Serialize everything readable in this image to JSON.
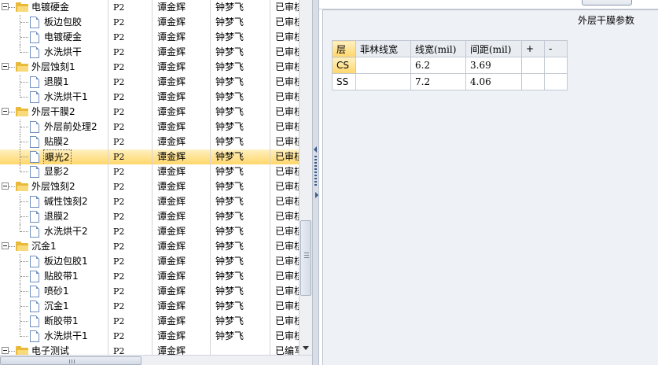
{
  "tree": {
    "rows": [
      {
        "level": 0,
        "type": "folder",
        "expanded": true,
        "name": "电镀硬金",
        "code": "P2",
        "person1": "谭金辉",
        "person2": "钟梦飞",
        "status": "已审核",
        "selected": false
      },
      {
        "level": 1,
        "type": "file",
        "name": "板边包胶",
        "code": "P2",
        "person1": "谭金辉",
        "person2": "钟梦飞",
        "status": "已审核",
        "selected": false
      },
      {
        "level": 1,
        "type": "file",
        "name": "电镀硬金",
        "code": "P2",
        "person1": "谭金辉",
        "person2": "钟梦飞",
        "status": "已审核",
        "selected": false
      },
      {
        "level": 1,
        "type": "file",
        "name": "水洗烘干",
        "code": "P2",
        "person1": "谭金辉",
        "person2": "钟梦飞",
        "status": "已审核",
        "selected": false
      },
      {
        "level": 0,
        "type": "folder",
        "expanded": true,
        "name": "外层蚀刻1",
        "code": "P2",
        "person1": "谭金辉",
        "person2": "钟梦飞",
        "status": "已审核",
        "selected": false
      },
      {
        "level": 1,
        "type": "file",
        "name": "退膜1",
        "code": "P2",
        "person1": "谭金辉",
        "person2": "钟梦飞",
        "status": "已审核",
        "selected": false
      },
      {
        "level": 1,
        "type": "file",
        "name": "水洗烘干1",
        "code": "P2",
        "person1": "谭金辉",
        "person2": "钟梦飞",
        "status": "已审核",
        "selected": false
      },
      {
        "level": 0,
        "type": "folder",
        "expanded": true,
        "name": "外层干膜2",
        "code": "P2",
        "person1": "谭金辉",
        "person2": "钟梦飞",
        "status": "已审核",
        "selected": false
      },
      {
        "level": 1,
        "type": "file",
        "name": "外层前处理2",
        "code": "P2",
        "person1": "谭金辉",
        "person2": "钟梦飞",
        "status": "已审核",
        "selected": false
      },
      {
        "level": 1,
        "type": "file",
        "name": "贴膜2",
        "code": "P2",
        "person1": "谭金辉",
        "person2": "钟梦飞",
        "status": "已审核",
        "selected": false
      },
      {
        "level": 1,
        "type": "file",
        "name": "曝光2",
        "code": "P2",
        "person1": "谭金辉",
        "person2": "钟梦飞",
        "status": "已审核",
        "selected": true
      },
      {
        "level": 1,
        "type": "file",
        "name": "显影2",
        "code": "P2",
        "person1": "谭金辉",
        "person2": "钟梦飞",
        "status": "已审核",
        "selected": false
      },
      {
        "level": 0,
        "type": "folder",
        "expanded": true,
        "name": "外层蚀刻2",
        "code": "P2",
        "person1": "谭金辉",
        "person2": "钟梦飞",
        "status": "已审核",
        "selected": false
      },
      {
        "level": 1,
        "type": "file",
        "name": "碱性蚀刻2",
        "code": "P2",
        "person1": "谭金辉",
        "person2": "钟梦飞",
        "status": "已审核",
        "selected": false
      },
      {
        "level": 1,
        "type": "file",
        "name": "退膜2",
        "code": "P2",
        "person1": "谭金辉",
        "person2": "钟梦飞",
        "status": "已审核",
        "selected": false
      },
      {
        "level": 1,
        "type": "file",
        "name": "水洗烘干2",
        "code": "P2",
        "person1": "谭金辉",
        "person2": "钟梦飞",
        "status": "已审核",
        "selected": false
      },
      {
        "level": 0,
        "type": "folder",
        "expanded": true,
        "name": "沉金1",
        "code": "P2",
        "person1": "谭金辉",
        "person2": "钟梦飞",
        "status": "已审核",
        "selected": false
      },
      {
        "level": 1,
        "type": "file",
        "name": "板边包胶1",
        "code": "P2",
        "person1": "谭金辉",
        "person2": "钟梦飞",
        "status": "已审核",
        "selected": false
      },
      {
        "level": 1,
        "type": "file",
        "name": "贴胶带1",
        "code": "P2",
        "person1": "谭金辉",
        "person2": "钟梦飞",
        "status": "已审核",
        "selected": false
      },
      {
        "level": 1,
        "type": "file",
        "name": "喷砂1",
        "code": "P2",
        "person1": "谭金辉",
        "person2": "钟梦飞",
        "status": "已审核",
        "selected": false
      },
      {
        "level": 1,
        "type": "file",
        "name": "沉金1",
        "code": "P2",
        "person1": "谭金辉",
        "person2": "钟梦飞",
        "status": "已审核",
        "selected": false
      },
      {
        "level": 1,
        "type": "file",
        "name": "断胶带1",
        "code": "P2",
        "person1": "谭金辉",
        "person2": "钟梦飞",
        "status": "已审核",
        "selected": false
      },
      {
        "level": 1,
        "type": "file",
        "name": "水洗烘干1",
        "code": "P2",
        "person1": "谭金辉",
        "person2": "钟梦飞",
        "status": "已审核",
        "selected": false
      },
      {
        "level": 0,
        "type": "folder",
        "expanded": true,
        "name": "电子测试",
        "code": "P2",
        "person1": "谭金辉",
        "person2": "",
        "status": "已编写",
        "selected": false
      }
    ]
  },
  "panel": {
    "title": "外层干膜参数",
    "table": {
      "headers": [
        "层",
        "菲林线宽",
        "线宽(mil)",
        "间距(mil)",
        "+",
        "-"
      ],
      "rows": [
        [
          "CS",
          "",
          "6.2",
          "3.69",
          "",
          ""
        ],
        [
          "SS",
          "",
          "7.2",
          "4.06",
          "",
          ""
        ]
      ]
    }
  },
  "colors": {
    "selection": "#ffd66a",
    "folder": "#e9b93a",
    "panel_bg": "#eef1f6"
  }
}
